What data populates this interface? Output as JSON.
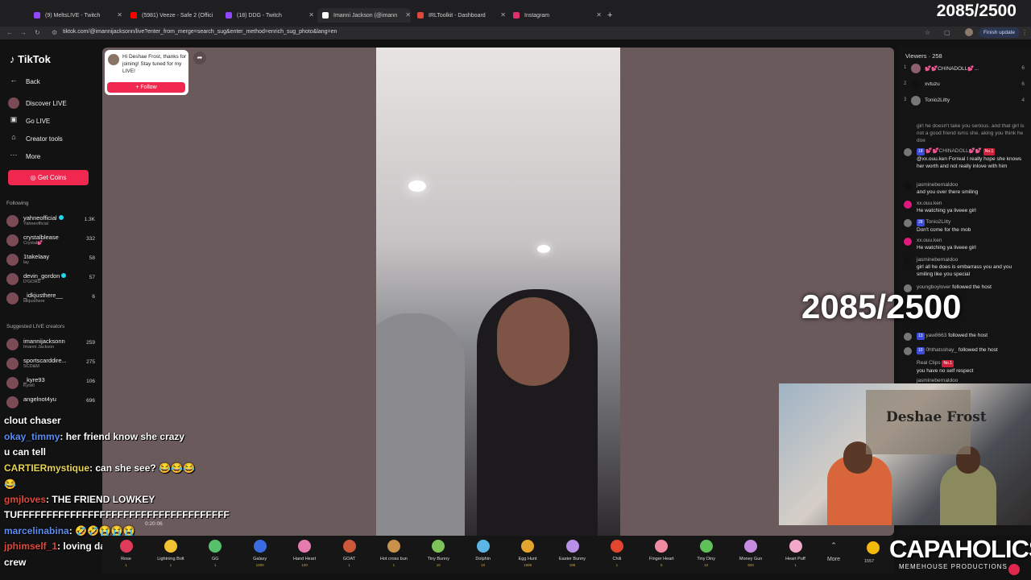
{
  "browser": {
    "tabs": [
      {
        "label": "(9) MeltsLIVE - Twitch",
        "color": "#9146ff"
      },
      {
        "label": "(5981) Veeze - Safe 2 (Offici",
        "color": "#ff0000"
      },
      {
        "label": "(18) DDG - Twitch",
        "color": "#9146ff"
      },
      {
        "label": "Imanni Jackson (@imann",
        "color": "#ffffff"
      },
      {
        "label": "IRLToolkit - Dashboard",
        "color": "#e0483b"
      },
      {
        "label": "Instagram",
        "color": "#e1306c"
      }
    ],
    "url": "tiktok.com/@imannijacksonn/live?enter_from_merge=search_sug&enter_method=enrich_sug_photo&lang=en",
    "finish_update": "Finish update"
  },
  "overlay": {
    "counter": "2085/2500"
  },
  "sidebar": {
    "logo": "TikTok",
    "back": "Back",
    "nav": [
      {
        "label": "Discover LIVE",
        "icon": "avatar-icon"
      },
      {
        "label": "Go LIVE",
        "icon": "live-icon"
      },
      {
        "label": "Creator tools",
        "icon": "creator-tools-icon"
      },
      {
        "label": "More",
        "icon": "more-icon"
      }
    ],
    "get_coins": "Get Coins",
    "following_label": "Following",
    "following": [
      {
        "name": "yahneofficial",
        "sub": "Yahneofficial",
        "count": "1.3K",
        "verified": true
      },
      {
        "name": "crystalblease",
        "sub": "Crystal💕",
        "count": "332",
        "verified": false
      },
      {
        "name": "1takelaay",
        "sub": "lay",
        "count": "58",
        "verified": false
      },
      {
        "name": "devin_gordon",
        "sub": "D'GORD",
        "count": "57",
        "verified": true
      },
      {
        "name": "_idkjusthere__",
        "sub": "idkjusthere",
        "count": "6",
        "verified": false
      }
    ],
    "suggested_label": "Suggested LIVE creators",
    "suggested": [
      {
        "name": "imannijacksonn",
        "sub": "Imanni Jackson",
        "count": "259"
      },
      {
        "name": "sportscarddire...",
        "sub": "SCD&M",
        "count": "275"
      },
      {
        "name": "_kyre93",
        "sub": "Kyrell",
        "count": "106"
      },
      {
        "name": "angelnot4yu",
        "sub": "",
        "count": "696"
      }
    ]
  },
  "main": {
    "follow_card_text": "Hi Deshae Frost, thanks for joining! Stay tuned for my LIVE!",
    "follow_button": "+ Follow",
    "timer": "0:20:06"
  },
  "gifts": [
    {
      "name": "Rose",
      "price": "1",
      "color": "#e03b5a"
    },
    {
      "name": "Lightning Bolt",
      "price": "1",
      "color": "#f2c230"
    },
    {
      "name": "GG",
      "price": "1",
      "color": "#56c16a"
    },
    {
      "name": "Galaxy",
      "price": "1000",
      "color": "#3a6be0"
    },
    {
      "name": "Hand Heart",
      "price": "100",
      "color": "#e67bb0"
    },
    {
      "name": "GOAT",
      "price": "1",
      "color": "#cc5a3a"
    },
    {
      "name": "Hot cross bun",
      "price": "1",
      "color": "#c8914c"
    },
    {
      "name": "Tiny Bunny",
      "price": "10",
      "color": "#7cc35a"
    },
    {
      "name": "Dolphin",
      "price": "10",
      "color": "#5bb6e6"
    },
    {
      "name": "Egg Hunt",
      "price": "1999",
      "color": "#e4a52e"
    },
    {
      "name": "Easter Bunny",
      "price": "199",
      "color": "#b890e8"
    },
    {
      "name": "Chili",
      "price": "1",
      "color": "#e2462f"
    },
    {
      "name": "Finger Heart",
      "price": "5",
      "color": "#f08aa0"
    },
    {
      "name": "Tiny Diny",
      "price": "10",
      "color": "#60c05a"
    },
    {
      "name": "Money Gun",
      "price": "500",
      "color": "#c68ce0"
    },
    {
      "name": "Heart Puff",
      "price": "1",
      "color": "#f2a8c8"
    }
  ],
  "gift_more": "More",
  "coins_count": "1557",
  "stream_chat": [
    {
      "user": "",
      "text": "clout chaser"
    },
    {
      "user": "okay_timmy",
      "text": ": her friend know she crazy"
    },
    {
      "user": "",
      "text": "u can tell"
    },
    {
      "user": "CARTIERmystique",
      "text": ": can she see? 😂😂😂"
    },
    {
      "user": "",
      "text": "😂"
    },
    {
      "user": "gmjloves",
      "text": ": THE FRIEND LOWKEY"
    },
    {
      "user": "",
      "text": "TUFFFFFFFFFFFFFFFFFFFFFFFFFFFFFFFFFFFF"
    },
    {
      "user": "marcelinabina",
      "text": ": 🤣🤣😭😭😭"
    },
    {
      "user": "jphimself_1",
      "text": ": loving da crew loving da"
    },
    {
      "user": "",
      "text": "crew"
    }
  ],
  "viewers": {
    "label": "Viewers",
    "count": "258",
    "top": [
      {
        "rank": "1",
        "name": "💕💕CHINADOLL💕...",
        "value": "6"
      },
      {
        "rank": "2",
        "name": "xvtuzu",
        "value": "6"
      },
      {
        "rank": "3",
        "name": "Tonio2Litty",
        "value": "4"
      }
    ]
  },
  "tiktok_chat": [
    {
      "user": "",
      "text": "girl he doesn't take you serious. and that girl is not a good friend isms she. aking you think he doe"
    },
    {
      "user": "💕💕CHINADOLL💕💕",
      "text": "@xx.ouu.ken Forreal I really hope she knows her worth and not really inlove with him"
    },
    {
      "user": "jasminebernaldoo",
      "text": "and you over there smiling"
    },
    {
      "user": "xx.ouu.ken",
      "text": "He watching ya liveee girl"
    },
    {
      "user": "Tonio2Litty",
      "text": "Don't come for the mob"
    },
    {
      "user": "xx.ouu.ken",
      "text": "He watching ya liveee girl"
    },
    {
      "user": "jasminebernaldoo",
      "text": "girl all he does is embarrass you and you smiling like you special"
    },
    {
      "user": "youngboylover",
      "text": "followed the host"
    },
    {
      "user": "yaw8663",
      "text": "followed the host"
    },
    {
      "user": "0hthatsshay_",
      "text": "followed the host"
    },
    {
      "user": "Real Clips",
      "text": "you have no self respect"
    },
    {
      "user": "jasminebernaldoo",
      "text": ""
    }
  ],
  "webcam": {
    "wall_text": "Deshae Frost"
  },
  "branding": {
    "name": "CAPAHOLICS",
    "sub": "MEMEHOUSE PRODUCTIONS"
  }
}
